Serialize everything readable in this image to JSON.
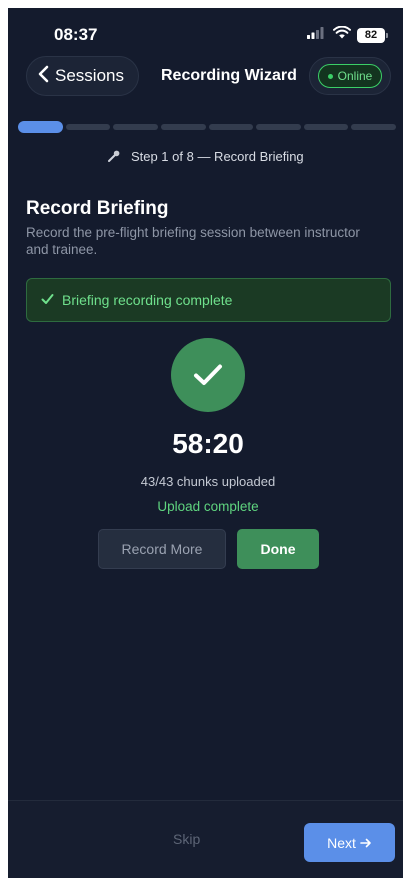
{
  "status_bar": {
    "time": "08:37",
    "battery": "82"
  },
  "nav": {
    "back_label": "Sessions",
    "title": "Recording Wizard",
    "status_badge": "Online"
  },
  "progress": {
    "total_steps": 8,
    "current_step": 1,
    "step_label": "Step 1 of 8 — Record Briefing"
  },
  "content": {
    "title": "Record Briefing",
    "description": "Record the pre-flight briefing session between instructor and trainee.",
    "banner_text": "Briefing recording complete",
    "timer": "58:20",
    "chunks_text": "43/43 chunks uploaded",
    "upload_status": "Upload complete",
    "record_more_label": "Record More",
    "done_label": "Done"
  },
  "footer": {
    "skip_label": "Skip",
    "next_label": "Next"
  },
  "colors": {
    "background": "#141b2d",
    "accent_blue": "#5b8fe8",
    "success_green": "#3e8f5a",
    "success_text": "#6fe08c"
  },
  "icons": {
    "back": "chevron-left-icon",
    "step": "microphone-icon",
    "banner": "checkmark-icon",
    "status": "check-circle-icon",
    "next": "arrow-right-icon"
  }
}
